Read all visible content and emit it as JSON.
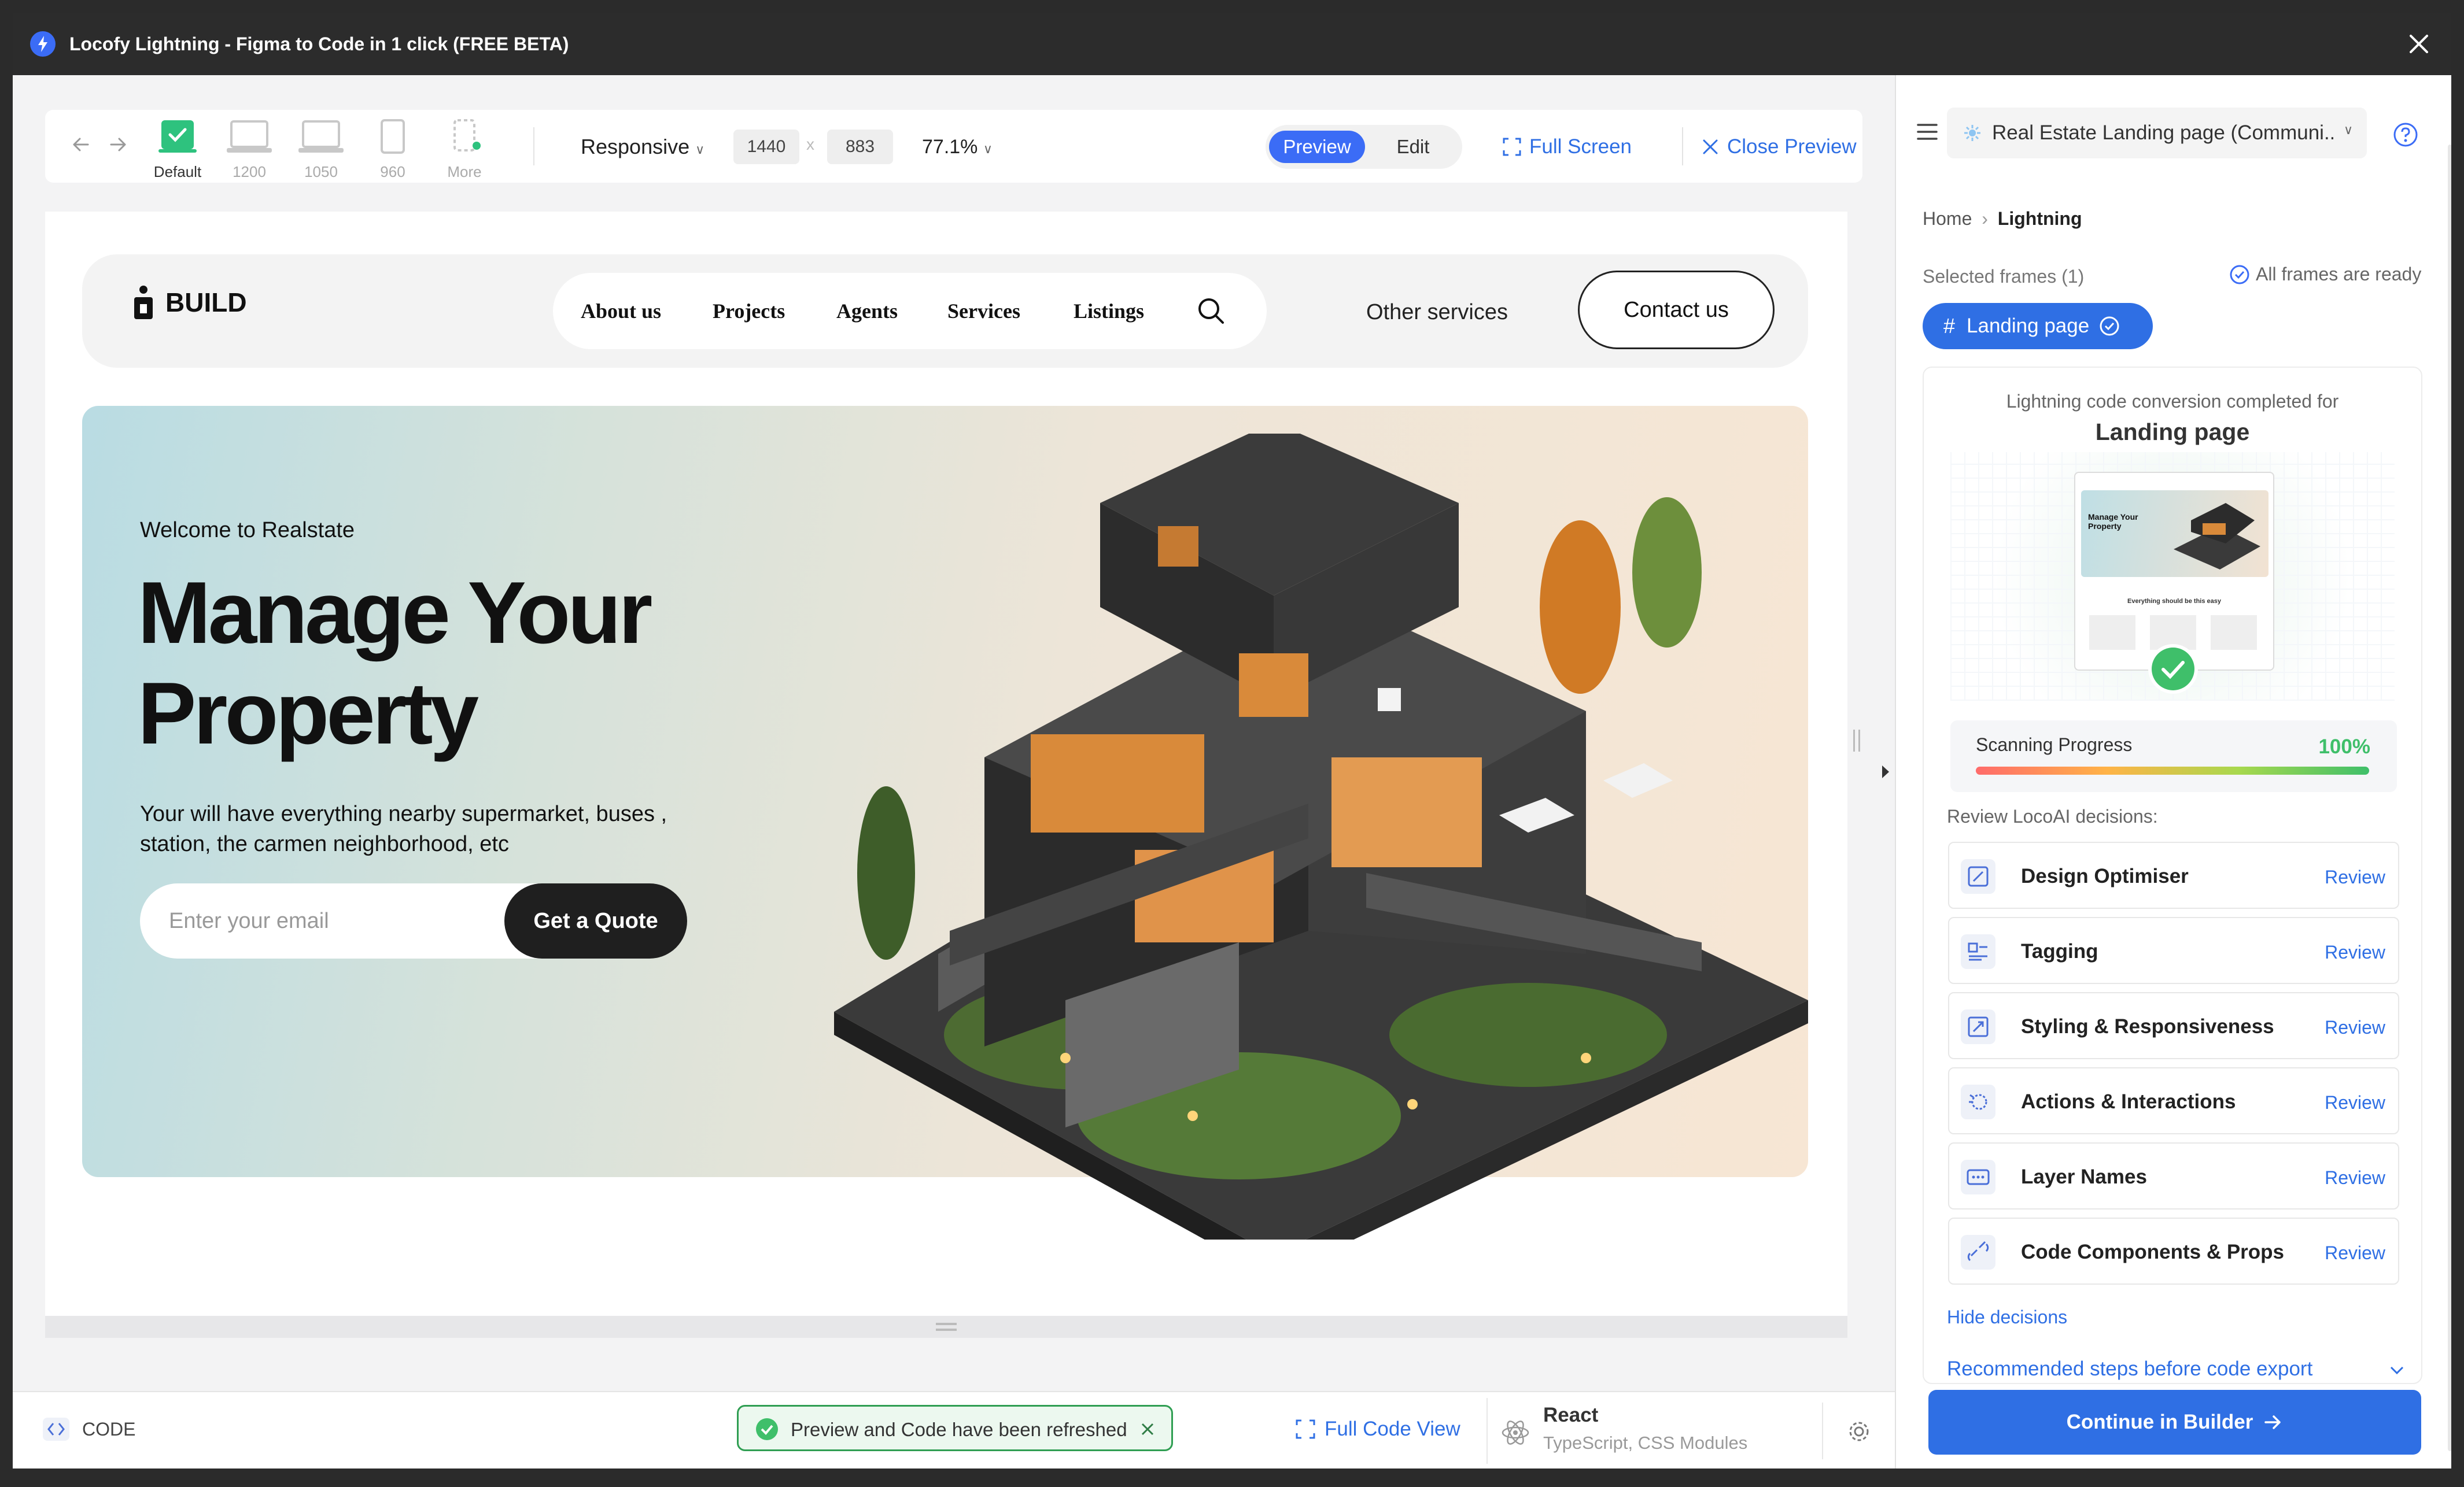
{
  "window": {
    "title": "Locofy Lightning - Figma to Code in 1 click (FREE BETA)"
  },
  "toolbar": {
    "devices": [
      {
        "label": "Default"
      },
      {
        "label": "1200"
      },
      {
        "label": "1050"
      },
      {
        "label": "960"
      },
      {
        "label": "More"
      }
    ],
    "mode": "Responsive",
    "width": "1440",
    "height": "883",
    "x_sep": "x",
    "zoom": "77.1%",
    "preview": "Preview",
    "edit": "Edit",
    "full_screen": "Full Screen",
    "close_preview": "Close Preview"
  },
  "site": {
    "brand": "BUILD",
    "nav": [
      "About us",
      "Projects",
      "Agents",
      "Services",
      "Listings"
    ],
    "other": "Other services",
    "contact": "Contact us",
    "welcome": "Welcome to Realstate",
    "headline1": "Manage Your",
    "headline2": "Property",
    "sub1": "Your will have everything nearby supermarket, buses ,",
    "sub2": "station, the carmen neighborhood, etc",
    "email_placeholder": "Enter your email",
    "quote": "Get a Quote"
  },
  "bottombar": {
    "code": "CODE",
    "toast": "Preview and Code have been refreshed",
    "full_code": "Full Code View",
    "framework": "React",
    "framework_sub": "TypeScript, CSS Modules"
  },
  "panel": {
    "project": "Real Estate Landing page (Communi...",
    "breadcrumb": {
      "home": "Home",
      "current": "Lightning"
    },
    "selected": "Selected frames (1)",
    "ready": "All frames are ready",
    "frame_chip": "Landing page",
    "completed": "Lightning code conversion completed for",
    "completed_frame": "Landing page",
    "thumb": {
      "headline": "Manage Your Property",
      "caption": "Everything should be this easy"
    },
    "progress_label": "Scanning Progress",
    "progress_value": "100%",
    "progress": 1.0,
    "review_title": "Review LocoAI decisions:",
    "decisions": [
      {
        "name": "Design Optimiser",
        "action": "Review",
        "icon": "optimiser-icon"
      },
      {
        "name": "Tagging",
        "action": "Review",
        "icon": "tag-icon"
      },
      {
        "name": "Styling & Responsiveness",
        "action": "Review",
        "icon": "responsive-icon"
      },
      {
        "name": "Actions & Interactions",
        "action": "Review",
        "icon": "cursor-icon"
      },
      {
        "name": "Layer Names",
        "action": "Review",
        "icon": "layers-icon"
      },
      {
        "name": "Code Components & Props",
        "action": "Review",
        "icon": "component-icon"
      }
    ],
    "hide": "Hide decisions",
    "recommended": "Recommended steps before code export",
    "continue": "Continue in Builder"
  },
  "colors": {
    "accent": "#3b6cf6",
    "link": "#2f6fe4",
    "success": "#3fbf6a",
    "dark": "#222222"
  }
}
